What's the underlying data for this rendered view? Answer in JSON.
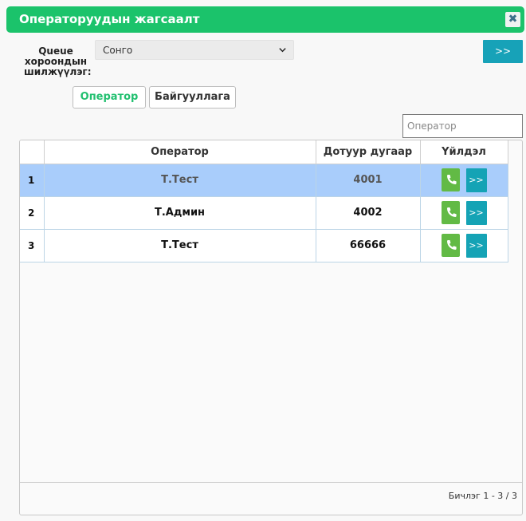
{
  "window": {
    "title": "Операторуудын жагсаалт",
    "close_glyph": "✖"
  },
  "queue": {
    "label": "Queue хороондын шилжүүлэг:",
    "selected": "Сонго",
    "forward_button": ">>"
  },
  "tabs": [
    {
      "label": "Оператор",
      "active": true
    },
    {
      "label": "Байгууллага",
      "active": false
    }
  ],
  "search": {
    "placeholder": "Оператор"
  },
  "table": {
    "columns": [
      "",
      "Оператор",
      "Дотуур дугаар",
      "Үйлдэл"
    ],
    "rows": [
      {
        "num": "1",
        "name": "Т.Тест",
        "ext": "4001",
        "selected": true
      },
      {
        "num": "2",
        "name": "Т.Админ",
        "ext": "4002",
        "selected": false
      },
      {
        "num": "3",
        "name": "Т.Тест",
        "ext": "66666",
        "selected": false
      }
    ],
    "forward_label": ">>"
  },
  "pager": {
    "text": "Бичлэг 1 - 3 / 3"
  },
  "colors": {
    "title_bar": "#1bc36b",
    "forward": "#17a2b8",
    "call": "#62ba45",
    "selected_row": "#a9cdfb",
    "active_tab": "#22c070"
  }
}
